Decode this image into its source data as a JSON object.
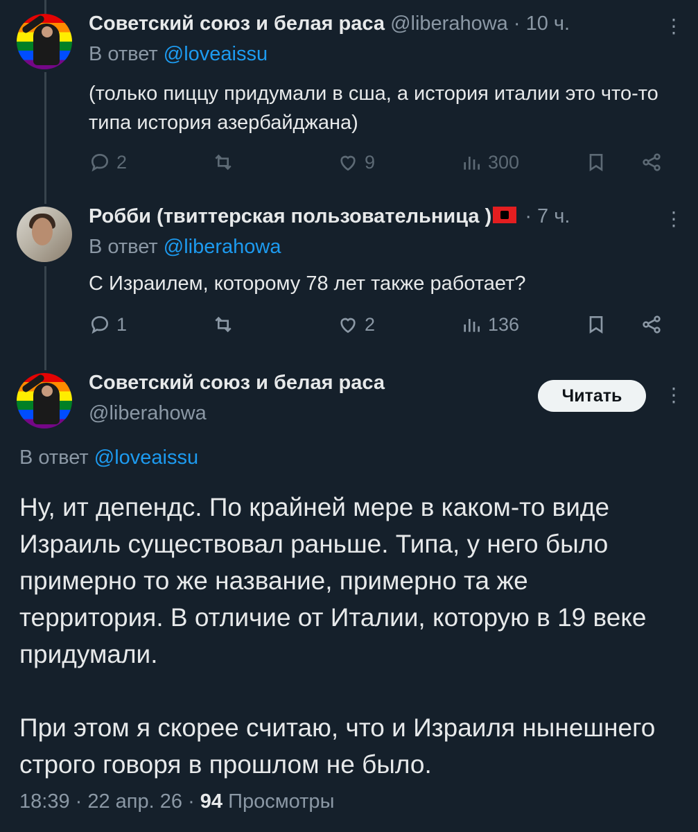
{
  "tweets": [
    {
      "name": "Советский союз и белая раса",
      "handle": "@liberahowa",
      "time": "10 ч.",
      "reply_label": "В ответ",
      "reply_to": "@loveaissu",
      "text": "(только пиццу придумали в сша, а история италии это что-то типа история азербайджана)",
      "replies": "2",
      "retweets": "",
      "likes": "9",
      "views": "300"
    },
    {
      "name": "Робби (твиттерская пользовательница )",
      "handle": "",
      "time": "7 ч.",
      "reply_label": "В ответ",
      "reply_to": "@liberahowa",
      "text": "С Израилем, которому 78 лет также работает?",
      "replies": "1",
      "retweets": "",
      "likes": "2",
      "views": "136"
    }
  ],
  "main": {
    "name": "Советский союз и белая раса",
    "handle": "@liberahowa",
    "follow_label": "Читать",
    "reply_label": "В ответ",
    "reply_to": "@loveaissu",
    "paragraphs": [
      "Ну, ит депендс. По крайней мере в каком-то виде Израиль существовал раньше. Типа, у него было примерно то же название, примерно та же территория. В отличие от Италии, которую в 19 веке придумали.",
      "При этом я скорее считаю, что и Израиля нынешнего строго говоря в прошлом не было."
    ],
    "time": "18:39",
    "date": "22 апр. 26",
    "views_count": "94",
    "views_label": "Просмотры"
  },
  "colors": {
    "background": "#15202b",
    "accent": "#1d9bf0",
    "muted": "#8b98a5",
    "text": "#e7e9ea"
  },
  "icons": [
    "reply-icon",
    "retweet-icon",
    "like-icon",
    "views-icon",
    "bookmark-icon",
    "share-icon",
    "more-icon"
  ]
}
